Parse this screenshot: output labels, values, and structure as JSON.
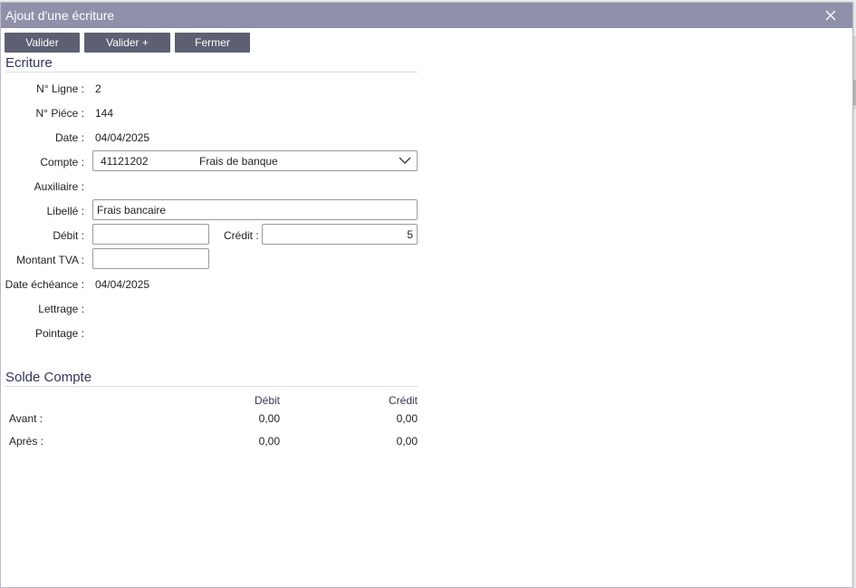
{
  "window": {
    "title": "Ajout d'une écriture"
  },
  "toolbar": {
    "valider": "Valider",
    "valider_plus": "Valider +",
    "fermer": "Fermer"
  },
  "ecriture": {
    "section_title": "Ecriture",
    "labels": {
      "ligne": "N° Ligne :",
      "piece": "N° Piéce :",
      "date": "Date :",
      "compte": "Compte :",
      "auxiliaire": "Auxiliaire :",
      "libelle": "Libellé :",
      "debit": "Débit :",
      "credit": "Crédit :",
      "montant_tva": "Montant TVA :",
      "date_echeance": "Date échéance :",
      "lettrage": "Lettrage :",
      "pointage": "Pointage :"
    },
    "values": {
      "ligne": "2",
      "piece": "144",
      "date": "04/04/2025",
      "compte_numero": "41121202",
      "compte_nom": "Frais de banque",
      "libelle": "Frais bancaire",
      "debit": "",
      "credit": "5",
      "montant_tva": "",
      "date_echeance": "04/04/2025"
    }
  },
  "solde": {
    "section_title": "Solde Compte",
    "col_debit": "Débit",
    "col_credit": "Crédit",
    "rows": [
      {
        "label": "Avant :",
        "debit": "0,00",
        "credit": "0,00"
      },
      {
        "label": "Après :",
        "debit": "0,00",
        "credit": "0,00"
      }
    ]
  },
  "icons": {
    "close": "close-icon",
    "dropdown": "chevron-down-icon"
  }
}
